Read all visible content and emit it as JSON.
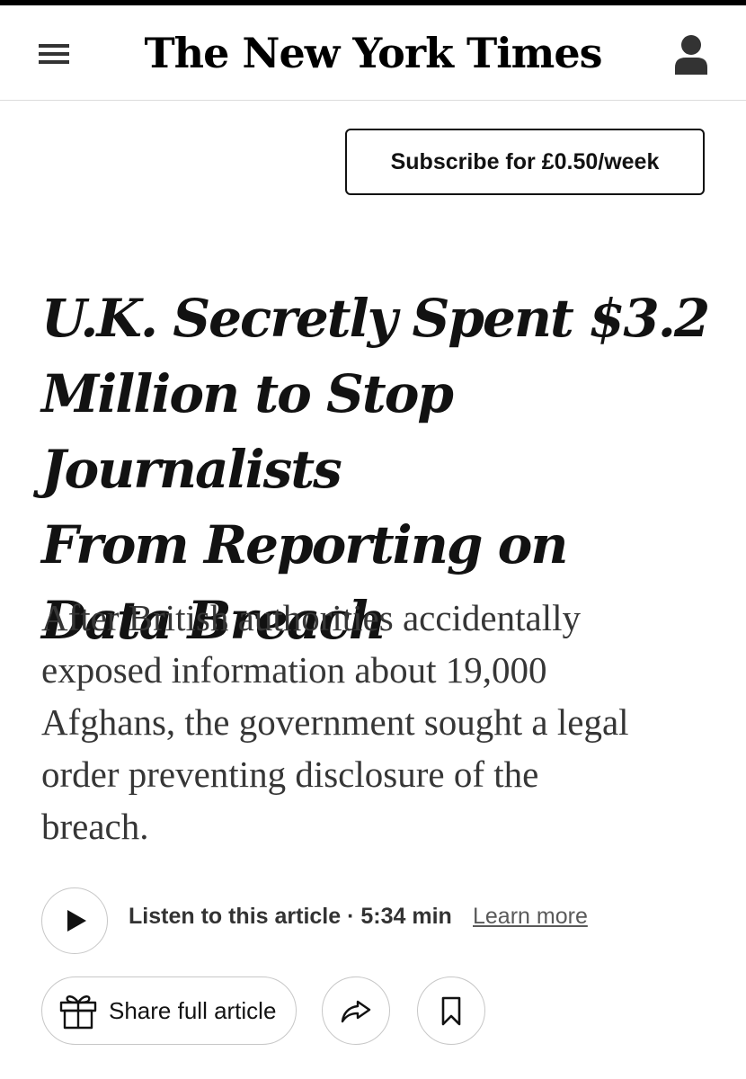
{
  "header": {
    "menu_icon": "hamburger-menu-icon",
    "logo_text": "The New York Times",
    "account_icon": "user-account-icon"
  },
  "subscribe": {
    "label": "Subscribe for £0.50/week"
  },
  "article": {
    "headline_lines": [
      "U.K. Secretly Spent $3.2",
      "Million to Stop Journalists",
      "From Reporting on",
      "Data Breach"
    ],
    "summary_lines": [
      "After British authorities accidentally",
      "exposed information about 19,000",
      "Afghans, the government sought a legal",
      "order preventing disclosure of the",
      "breach."
    ]
  },
  "audio": {
    "play_icon": "play-icon",
    "listen_label": "Listen to this article · 5:34 min",
    "learn_more": "Learn more"
  },
  "actions": {
    "gift_icon": "gift-icon",
    "share_full_label": "Share full article",
    "share_icon": "share-arrow-icon",
    "bookmark_icon": "bookmark-icon"
  },
  "colors": {
    "text": "#121212",
    "summary": "#363636",
    "border": "#c7c7c7"
  }
}
